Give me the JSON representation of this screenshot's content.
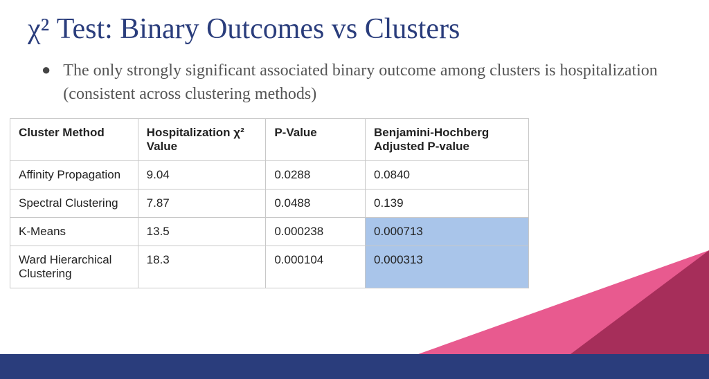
{
  "title": "χ² Test: Binary Outcomes vs Clusters",
  "bullet": "The only strongly significant associated binary outcome among clusters is hospitalization (consistent across clustering methods)",
  "table": {
    "headers": {
      "method": "Cluster Method",
      "chi2": "Hospitalization χ² Value",
      "pvalue": "P-Value",
      "adjusted": "Benjamini-Hochberg Adjusted P-value"
    },
    "rows": [
      {
        "method": "Affinity Propagation",
        "chi2": "9.04",
        "pvalue": "0.0288",
        "adjusted": "0.0840",
        "highlight": false
      },
      {
        "method": "Spectral Clustering",
        "chi2": "7.87",
        "pvalue": "0.0488",
        "adjusted": "0.139",
        "highlight": false
      },
      {
        "method": "K-Means",
        "chi2": "13.5",
        "pvalue": "0.000238",
        "adjusted": "0.000713",
        "highlight": true
      },
      {
        "method": "Ward Hierarchical Clustering",
        "chi2": "18.3",
        "pvalue": "0.000104",
        "adjusted": "0.000313",
        "highlight": true
      }
    ]
  },
  "chart_data": {
    "type": "table",
    "title": "χ² Test: Binary Outcomes vs Clusters",
    "columns": [
      "Cluster Method",
      "Hospitalization χ² Value",
      "P-Value",
      "Benjamini-Hochberg Adjusted P-value"
    ],
    "rows": [
      [
        "Affinity Propagation",
        9.04,
        0.0288,
        0.084
      ],
      [
        "Spectral Clustering",
        7.87,
        0.0488,
        0.139
      ],
      [
        "K-Means",
        13.5,
        0.000238,
        0.000713
      ],
      [
        "Ward Hierarchical Clustering",
        18.3,
        0.000104,
        0.000313
      ]
    ],
    "highlighted_rows_adjusted_pvalue": [
      2,
      3
    ]
  }
}
